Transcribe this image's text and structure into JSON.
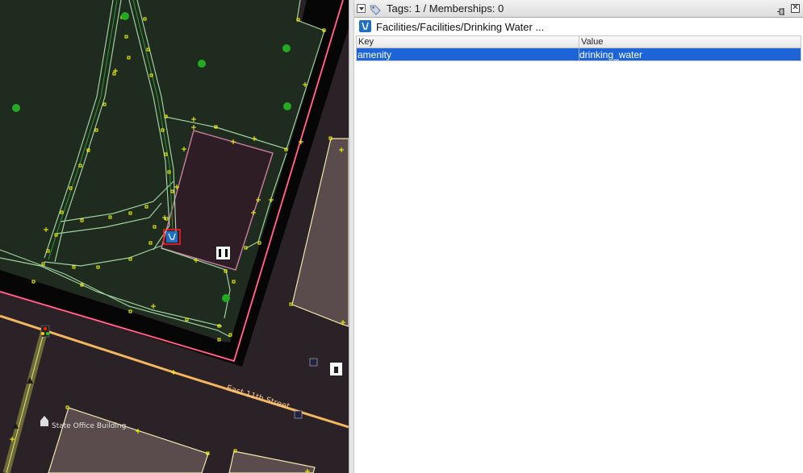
{
  "panel": {
    "title": "Tags: 1 / Memberships: 0",
    "preset_label": "Facilities/Facilities/Drinking Water ...",
    "table": {
      "headers": {
        "key": "Key",
        "value": "Value"
      },
      "rows": [
        {
          "key": "amenity",
          "value": "drinking_water"
        }
      ]
    }
  },
  "map": {
    "street_label": "East 11th Street",
    "building_label": "State Office Building"
  },
  "icons": {
    "collapse": "chevron-down-icon",
    "tag": "tag-icon",
    "pin": "pin-icon",
    "close": "close-icon",
    "preset": "drinking-water-icon"
  },
  "colors": {
    "selection": "#1c64d8",
    "park": "#1e2b1e",
    "node": "#ffff00",
    "boundary": "#ff3366",
    "road": "#f4b760"
  }
}
